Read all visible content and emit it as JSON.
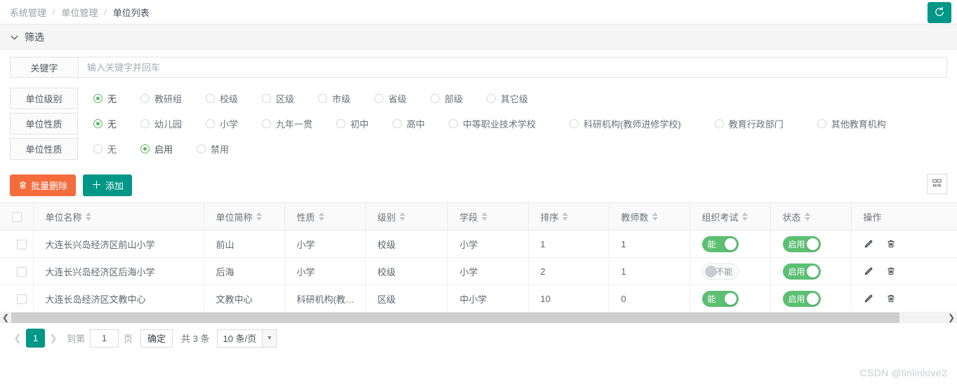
{
  "breadcrumb": {
    "items": [
      "系统管理",
      "单位管理",
      "单位列表"
    ],
    "separator": "/"
  },
  "header": {
    "refresh_icon": "refresh-icon"
  },
  "filter": {
    "title": "筛选",
    "collapse_icon": "chevron-down-icon",
    "keyword": {
      "label": "关键字",
      "value": "",
      "placeholder": "输入关键字并回车"
    },
    "groups": [
      {
        "label": "单位级别",
        "selected": "无",
        "options": [
          "无",
          "教研组",
          "校级",
          "区级",
          "市级",
          "省级",
          "部级",
          "其它级"
        ]
      },
      {
        "label": "单位性质",
        "selected": "无",
        "options": [
          "无",
          "幼儿园",
          "小学",
          "九年一贯",
          "初中",
          "高中",
          "中等职业技术学校",
          "科研机构(教师进修学校)",
          "教育行政部门",
          "其他教育机构"
        ]
      },
      {
        "label": "单位性质",
        "selected": "启用",
        "options": [
          "无",
          "启用",
          "禁用"
        ]
      }
    ]
  },
  "toolbar": {
    "batch_delete_label": "批量删除",
    "batch_delete_icon": "trash-icon",
    "add_label": "添加",
    "add_icon": "plus-icon",
    "column_settings_icon": "columns-icon",
    "colors": {
      "danger": "#f56c3c",
      "primary": "#009688"
    }
  },
  "table": {
    "columns": [
      {
        "label": "单位名称",
        "sortable": true
      },
      {
        "label": "单位简称",
        "sortable": true
      },
      {
        "label": "性质",
        "sortable": true
      },
      {
        "label": "级别",
        "sortable": true
      },
      {
        "label": "学段",
        "sortable": true
      },
      {
        "label": "排序",
        "sortable": true
      },
      {
        "label": "教师数",
        "sortable": true
      },
      {
        "label": "组织考试",
        "sortable": true
      },
      {
        "label": "状态",
        "sortable": true
      },
      {
        "label": "操作",
        "sortable": false
      }
    ],
    "rows": [
      {
        "name": "大连长兴岛经济区前山小学",
        "short_name": "前山",
        "nature": "小学",
        "level": "校级",
        "stage": "小学",
        "sort": "1",
        "teachers": "1",
        "exam": {
          "state": "on",
          "label": "能"
        },
        "status": {
          "state": "on",
          "label": "启用"
        },
        "edit_icon": "pencil-icon",
        "delete_icon": "trash-icon"
      },
      {
        "name": "大连长兴岛经济区后海小学",
        "short_name": "后海",
        "nature": "小学",
        "level": "校级",
        "stage": "小学",
        "sort": "2",
        "teachers": "1",
        "exam": {
          "state": "off",
          "label": "不能"
        },
        "status": {
          "state": "on",
          "label": "启用"
        },
        "edit_icon": "pencil-icon",
        "delete_icon": "trash-icon"
      },
      {
        "name": "大连长岛经济区文教中心",
        "short_name": "文教中心",
        "nature": "科研机构(教…",
        "level": "区级",
        "stage": "中小学",
        "sort": "10",
        "teachers": "0",
        "exam": {
          "state": "on",
          "label": "能"
        },
        "status": {
          "state": "on",
          "label": "启用"
        },
        "edit_icon": "pencil-icon",
        "delete_icon": "trash-icon"
      }
    ]
  },
  "scrollbar": {
    "left_arrow": "chevron-left-icon",
    "right_arrow": "chevron-right-icon"
  },
  "pagination": {
    "prev_icon": "chevron-left-icon",
    "next_icon": "chevron-right-icon",
    "current_page": "1",
    "jump_prefix": "到第",
    "jump_value": "1",
    "jump_suffix": "页",
    "confirm_label": "确定",
    "total_label": "共 3 条",
    "page_size": "10 条/页",
    "page_size_caret": "chevron-down-icon"
  },
  "watermark": "CSDN @linlinlove2"
}
